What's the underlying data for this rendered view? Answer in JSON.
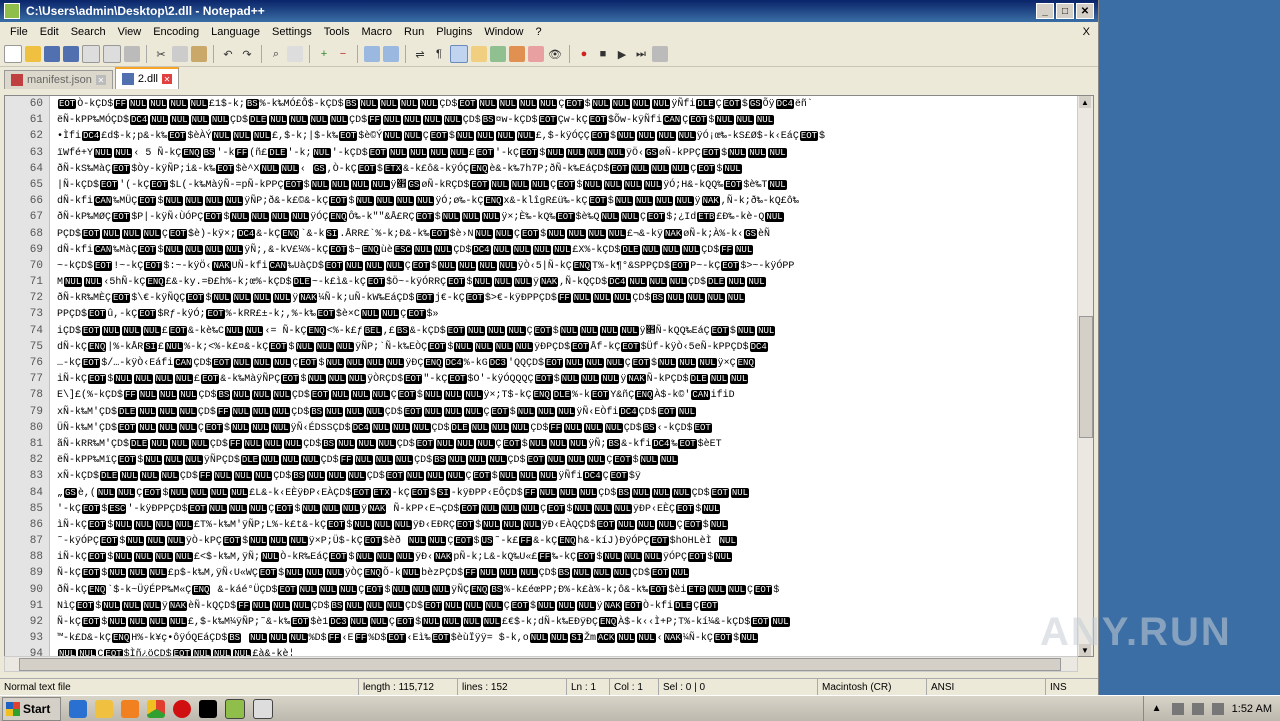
{
  "window": {
    "title": "C:\\Users\\admin\\Desktop\\2.dll - Notepad++"
  },
  "menu": [
    "File",
    "Edit",
    "Search",
    "View",
    "Encoding",
    "Language",
    "Settings",
    "Tools",
    "Macro",
    "Run",
    "Plugins",
    "Window",
    "?"
  ],
  "menu_close": "X",
  "tabs": [
    {
      "label": "manifest.json",
      "active": false
    },
    {
      "label": "2.dll",
      "active": true
    }
  ],
  "editor": {
    "line_numbers": [
      "60",
      "61",
      "62",
      "63",
      "64",
      "65",
      "66",
      "67",
      "68",
      "69",
      "70",
      "71",
      "72",
      "73",
      "74",
      "75",
      "76",
      "77",
      "78",
      "79",
      "80",
      "81",
      "82",
      "83",
      "84",
      "85",
      "86",
      "87",
      "88",
      "89",
      "90",
      "91",
      "92",
      "93",
      "94"
    ],
    "lines": [
      "EOTÒ-kÇD$FFNULNULNULNUL£1$-k;BS%-k‰MÓ£Ô$-kÇD$BSNULNULNULNULÇD$EOTNULNULNULNULÇEOT$NULNULNULNULÿÑfiDLEÇEOT$GSÕÿDC4ëñ`",
      "ëÑ-kPP‰MÓÇD$DC4NULNULNULNULÇD$DLENULNULNULNULÇD$FFNULNULNULNULÇD$BS¤w-kÇD$EOTÇw-kÇEOT$Õw-kÿÑfiCANÇEOT$NULNULNUL",
      "•ÌfiDC4£d$-k;p&-k‰EOT$èÀÝNULNULNUL£,$-k;|$-k‰EOT$è©ÝNULNULÇEOT$NULNULNULNUL£,$-kÿÓÇÇEOT$NULNULNULNULÿÓ¡œ‰-kS£Ø$-k‹EáÇEOT$",
      "ïWfé+YNULNUL‹ 5 Ñ-kÇENQBS'-kFF(ñ£DLE'-k;NUL'-kÇD$EOTNULNULNULNUL£EOT'-kÇEOT$NULNULNULNULÿÖ‹GSøÑ-kPPÇEOT$NULNULNUL",
      "ðÑ-kS‰MàÇEOT$Òy-kÿÑP;i&-k‰EOT$è^XNULNUL‹ GS,Ò-kÇEOT$ETX&-k£ô&-kÿÓÇENQè&-k‰7h7P;ðÑ-k‰EáÇD$EOTNULNULNULÇEOT$NUL",
      "|Ñ-kÇD$EOT'(-kÇEOT$L(-k‰MàÿÑ-=pÑ-kPPÇEOT$NULNULNULNULÿ׋GSøÑ-kRÇD$EOTNULNULNULÇEOT$NULNULNULNULÿÓ;H&-kQQ‰EOT$è‰TNUL",
      "dÑ-kfiCAN‰MÜÇEOT$NULNULNULNULÿÑP;ð&-k£©&-kÇEOT$NULNULNULNULÿÓ;ø‰-kÇENQx&-klîgR£ü‰-kÇEOT$NULNULNULNULÿNAK,Ñ-k;ð‰-kQ£ô‰",
      "ðÑ-kP‰MØÇEOT$P|-kÿÑ‹ÙÓPÇEOT$NULNULNULNULÿÓÇENQÔ‰-k\"\"&Å£RÇEOT$NULNULNULÿ×;È‰-kQ‰EOT$è‰QNULNULÇEOT$;¿IdETB£Ð‰-kè-QNUL",
      "PÇD$EOTNULNULNULÇEOT$è)-kÿ×;DC4&-kÇENQ`&-kSI.ÅRR£`%-k;Ð&-k‰EOT$è›NNULNULÇEOT$NULNULNULNUL£¬&-kÿNAKøÑ-k;À%-k‹GSèÑ",
      "dÑ-kfiCAN‰MàÇEOT$NULNULNULNULÿÑ;,&-kV£¼%-kÇEOT$~ENQùèESCNULNULÇD$DC4NULNULNULNUL£X%-kÇD$DLENULNULNULÇD$FFNUL",
      "~-kÇD$EOT!~-kÇEOT$:~-kÿÖ‹NAKUÑ-kfiCAN‰UàÇD$EOTNULNULNULÇEOT$NULNULNULNULÿÒ‹5|Ñ-kÇENQT%-k¶°&SPPÇD$EOTP~-kÇEOT$>~-kÿÓPP",
      "MNULNUL‹5hÑ-kÇENQ£&-ky.=Ð£h%-k;œ%-kÇD$DLE~-k£ì&-kÇEOT$Ö~-kÿÓRRÇEOT$NULNULNULÿNAK,Ñ-kQÇD$DC4NULNULNULÇD$DLENULNUL",
      "ðÑ-kR‰MÈÇEOT$\\€-kÿÑQÇEOT$NULNULNULNULÿNAK¼Ñ-k;uÑ-kW‰EáÇD$EOTj€-kÇEOT$>€-kÿÐPPÇD$FFNULNULNULÇD$BSNULNULNULNUL",
      "PPÇD$EOTû,-kÇEOT$Rƒ-kÿÓ;EOT%-kRR£±-k;,%-k‰EOT$è×CNULNULÇEOT$»",
      "iÇD$EOTNULNULNUL£EOT&-kè‰CNULNUL‹= Ñ-kÇENQ<%-k£ƒBEL,£BS&-kÇD$EOTNULNULNULÇEOT$NULNULNULNULÿ׋Ñ-kQQ‰EáÇEOT$NULNUL",
      "dÑ-kÇENQ|%-kÅRSI£NUL%-k;<%-k£¤&-kÇEOT$NULNULNULÿÑP;`Ñ-k‰EÒÇEOT$NULNULNULNULÿÐPÇD$EOTÅf-kÇEOT$Üf-kÿÒ‹5eÑ-kPPÇD$DC4",
      "…-kÇEOT$/…-kÿÒ‹EáfiCANÇD$EOTNULNULNULÇEOT$NULNULNULNULÿÐÇENQDC4%-kGDC3'QQÇD$EOTNULNULNULÇEOT$NULNULNULÿ×ÇENQ",
      "iÑ-kÇEOT$NULNULNULNUL£EOT&-k‰MàÿÑPÇEOT$NULNULNULÿÒRÇD$EOT\"-kÇEOT$O'-kÿÓQQQÇEOT$NULNULNULÿNAKÑ-kPÇD$DLENULNUL",
      "E\\]£(%-kÇD$FFNULNULNULÇD$BSNULNULNULÇD$EOTNULNULNULÇEOT$NULNULNULÿ×;T$-kÇENQDLE%-kEOTY&ñÇENQÀ$-k©'CANifiD",
      "xÑ-k‰M'ÇD$DLENULNULNULÇD$FFNULNULNULÇD$BSNULNULNULÇD$EOTNULNULNULÇEOT$NULNULNULÿÑ‹EÒfiDC4ÇD$EOTNUL",
      "ÜÑ-k‰M'ÇD$EOTNULNULNULÇEOT$NULNULNULÿÑ‹ÉDSSÇD$DC4NULNULNULÇD$DLENULNULNULÇD$FFNULNULNULÇD$BS‹-kÇD$EOT",
      "ãÑ-kRR‰M'ÇD$DLENULNULNULÇD$FFNULNULNULÇD$BSNULNULNULÇD$EOTNULNULNULÇEOT$NULNULNULÿÑ;BS&-kfiDC4‰EOT$èET",
      "ëÑ-kPP‰MïÇEOT$NULNULNULÿÑPÇD$DLENULNULNULÇD$FFNULNULNULÇD$BSNULNULNULÇD$EOTNULNULNULÇEOT$NULNUL",
      "xÑ-kÇD$DLENULNULNULÇD$FFNULNULNULÇD$BSNULNULNULÇD$EOTNULNULNULÇEOT$NULNULNULÿÑfiDC4ÇEOT$ÿ",
      "„GSè,(NULNULÇEOT$NULNULNULNUL£L&-k‹EÈÿÐP‹EÀÇD$EOTETX-kÇEOT$SI-kÿÐPP‹EÔÇD$FFNULNULNULÇD$BSNULNULNULÇD$EOTNUL",
      "'-kÇEOT$ESC'-kÿÐPPÇD$EOTNULNULNULÇEOT$NULNULNULÿNAK Ñ-kPP‹E¬ÇD$EOTNULNULNULÇEOT$NULNULNULÿÐP‹EÈÇEOT$NUL",
      "ìÑ-kÇEOT$NULNULNULNUL£T%-k‰M'ÿÑP;L%-k£t&-kÇEOT$NULNULNULÿÐ‹EÐRÇEOT$NULNULNULÿÐ‹EÀQÇD$EOTNULNULNULÇEOT$NUL",
      "˜-kÿÓPÇEOT$NULNULNULÿÒ-kPÇEOT$NULNULNULÿ×P;Ü$-kÇEOT$èð NULNULÇEOT$US˜-k£FF&-kÇENQh&-kíJ)ÐÿÓPÇEOT$hOHLèÌ NUL",
      "iÑ-kÇEOT$NULNULNULNUL£<$-k‰M,ÿÑ;NULÒ-kR‰EáÇEOT$NULNULNULÿÐ‹NAKpÑ-k;L&-kQ‰U«£FF‰-kÇEOT$NULNULNULÿÓPÇEOT$NUL",
      "Ñ-kÇEOT$NULNULNUL£p$-k‰M,ÿÑ‹U«WÇEOT$NULNULNULÿÒÇENQÕ-kNULbèzPÇD$FFNULNULNULÇD$BSNULNULNULÇD$EOTNUL",
      "ðÑ-kÇENQ`$-k~ÜÿÉPP‰M«ÇENQ &-káé°ÜÇD$EOTNULNULNULÇEOT$NULNULNULÿÑÇENQBS%-k£éœPP;Ð%-k£à%-k;ô&-k‰EOT$èiETBNULNULÇEOT$",
      "NìÇEOT$NULNULNULÿNAKèÑ-kQÇD$FFNULNULNULÇD$BSNULNULNULÇD$EOTNULNULNULÇEOT$NULNULNULÿNAKEOTÒ-kfiDLEÇEOT",
      "Ñ-kÇEOT$NULNULNULNUL£,$-k‰M¼ÿÑP;˜&-k‰EOT$è1DC3NULNULÇEOT$NULNULNULNUL£€$-k;dÑ-k‰EÐÿÐÇENQÀ$-k‹‹Ì+P;T%-kí¼&-kÇD$EOTNUL",
      "™-k£D&-kÇENQH%-k¥ç•ôÿÓQEáÇD$BS NULNULNUL%D$FF‹EFF%D$EOT‹Eì‰EOT$èùÏÿÿ= $-k,oNULNULSIŽmACKNULNUL‹NAK¼Ñ-kÇEOT$NUL",
      "NULNULÇEOT$Ìñ¿öÇD$EOTNULNULNUL£à&-kè¦"
    ]
  },
  "statusbar": {
    "type": "Normal text file",
    "length": "length : 115,712",
    "lines": "lines : 152",
    "ln": "Ln : 1",
    "col": "Col : 1",
    "sel": "Sel : 0 | 0",
    "eol": "Macintosh (CR)",
    "encoding": "ANSI",
    "mode": "INS"
  },
  "taskbar": {
    "start_label": "Start",
    "clock": "1:52 AM"
  },
  "watermark": "ANY.RUN"
}
